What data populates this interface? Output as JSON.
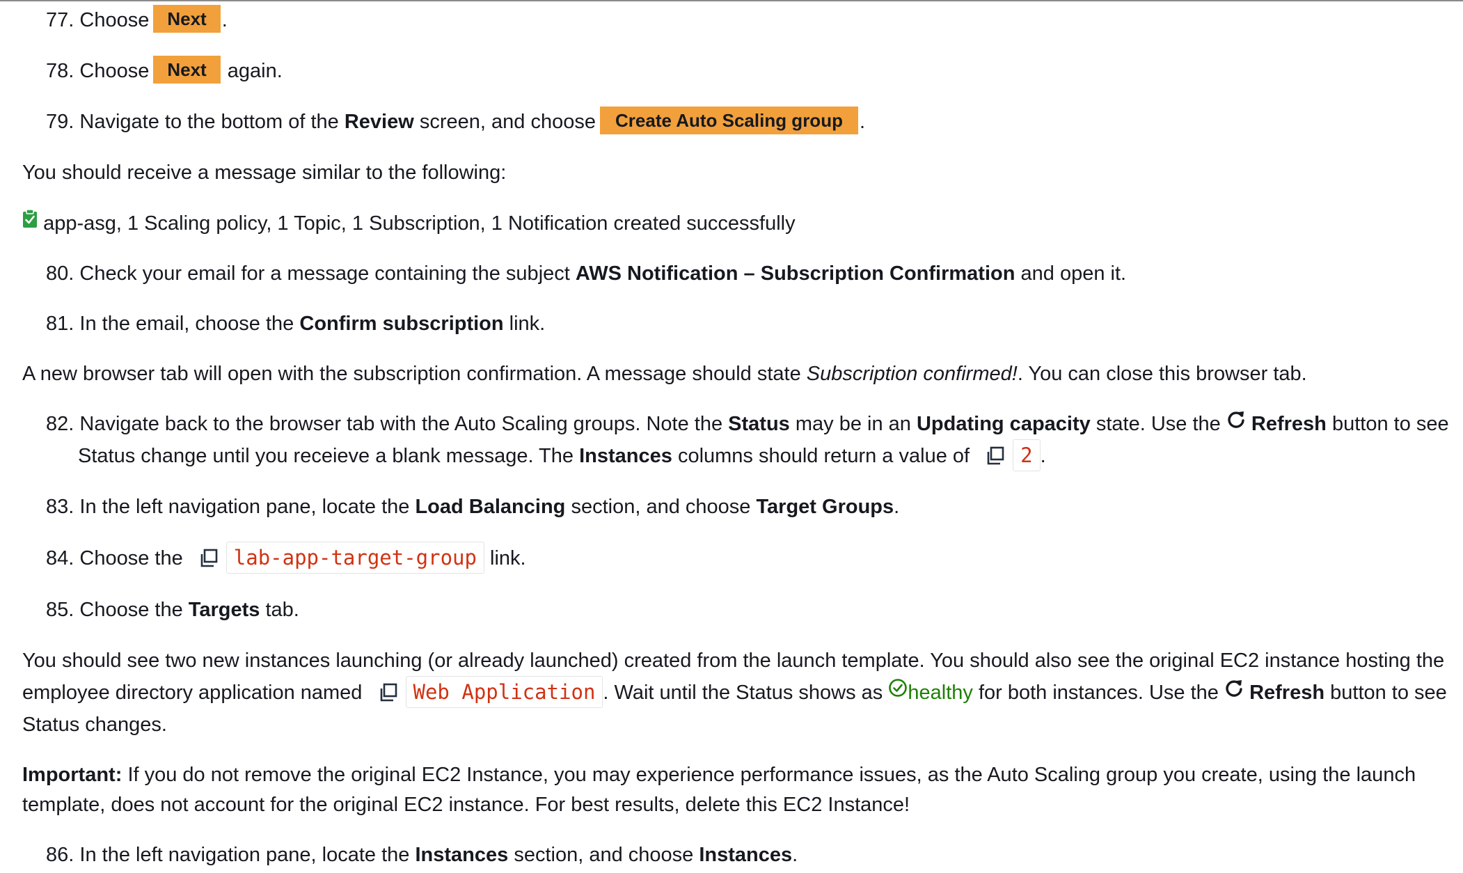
{
  "steps": {
    "s77": {
      "num": "77.",
      "pre": "Choose",
      "btn": "Next",
      "post": "."
    },
    "s78": {
      "num": "78.",
      "pre": "Choose",
      "btn": "Next",
      "post": "again."
    },
    "s79": {
      "num": "79.",
      "pre": "Navigate to the bottom of the",
      "bold": "Review",
      "mid": "screen, and choose",
      "btn": "Create Auto Scaling group",
      "post": "."
    },
    "s80": {
      "num": "80.",
      "pre": "Check your email for a message containing the subject",
      "bold": "AWS Notification – Subscription Confirmation",
      "post": "and open it."
    },
    "s81": {
      "num": "81.",
      "pre": "In the email, choose the",
      "bold": "Confirm subscription",
      "post": "link."
    },
    "s82": {
      "num": "82.",
      "t1": "Navigate back to the browser tab with the Auto Scaling groups. Note the",
      "b1": "Status",
      "t2": "may be in an",
      "b2": "Updating capacity",
      "t3": "state. Use the",
      "b3": "Refresh",
      "t4": "button to see",
      "t5": "Status change until you receieve a blank message. The",
      "b4": "Instances",
      "t6": "columns should return a value of",
      "code": "2",
      "post": "."
    },
    "s83": {
      "num": "83.",
      "pre": "In the left navigation pane, locate the",
      "b1": "Load Balancing",
      "mid": "section, and choose",
      "b2": "Target Groups",
      "post": "."
    },
    "s84": {
      "num": "84.",
      "pre": "Choose the",
      "code": "lab-app-target-group",
      "post": "link."
    },
    "s85": {
      "num": "85.",
      "pre": "Choose the",
      "bold": "Targets",
      "post": "tab."
    },
    "s86": {
      "num": "86.",
      "pre": "In the left navigation pane, locate the",
      "b1": "Instances",
      "mid": "section, and choose",
      "b2": "Instances",
      "post": "."
    }
  },
  "paragraphs": {
    "p_message_intro": "You should receive a message similar to the following:",
    "p_success": "app-asg, 1 Scaling policy, 1 Topic, 1 Subscription, 1 Notification created successfully",
    "p_tab": {
      "pre": "A new browser tab will open with the subscription confirmation. A message should state",
      "italic": "Subscription confirmed!",
      "post": ". You can close this browser tab."
    },
    "p_instances": {
      "l1": "You should see two new instances launching (or already launched) created from the launch template. You should also see the original EC2 instance hosting the",
      "l2a": "employee directory application named",
      "code": "Web Application",
      "l2b": ". Wait until the Status shows as",
      "healthy": "healthy",
      "l2c": "for both instances. Use the",
      "refresh": "Refresh",
      "l2d": "button to see",
      "l3": "Status changes."
    },
    "p_important": {
      "label": "Important:",
      "l1": "If you do not remove the original EC2 Instance, you may experience performance issues, as the Auto Scaling group you create, using the launch",
      "l2": "template, does not account for the original EC2 instance. For best results, delete this EC2 Instance!"
    }
  },
  "colors": {
    "button": "#f2a03c",
    "code": "#d13212",
    "healthy": "#1d8102",
    "success_icon": "#2e9e45"
  },
  "icons": [
    "copy-icon",
    "refresh-icon",
    "check-circle-icon",
    "clipboard-check-icon"
  ]
}
